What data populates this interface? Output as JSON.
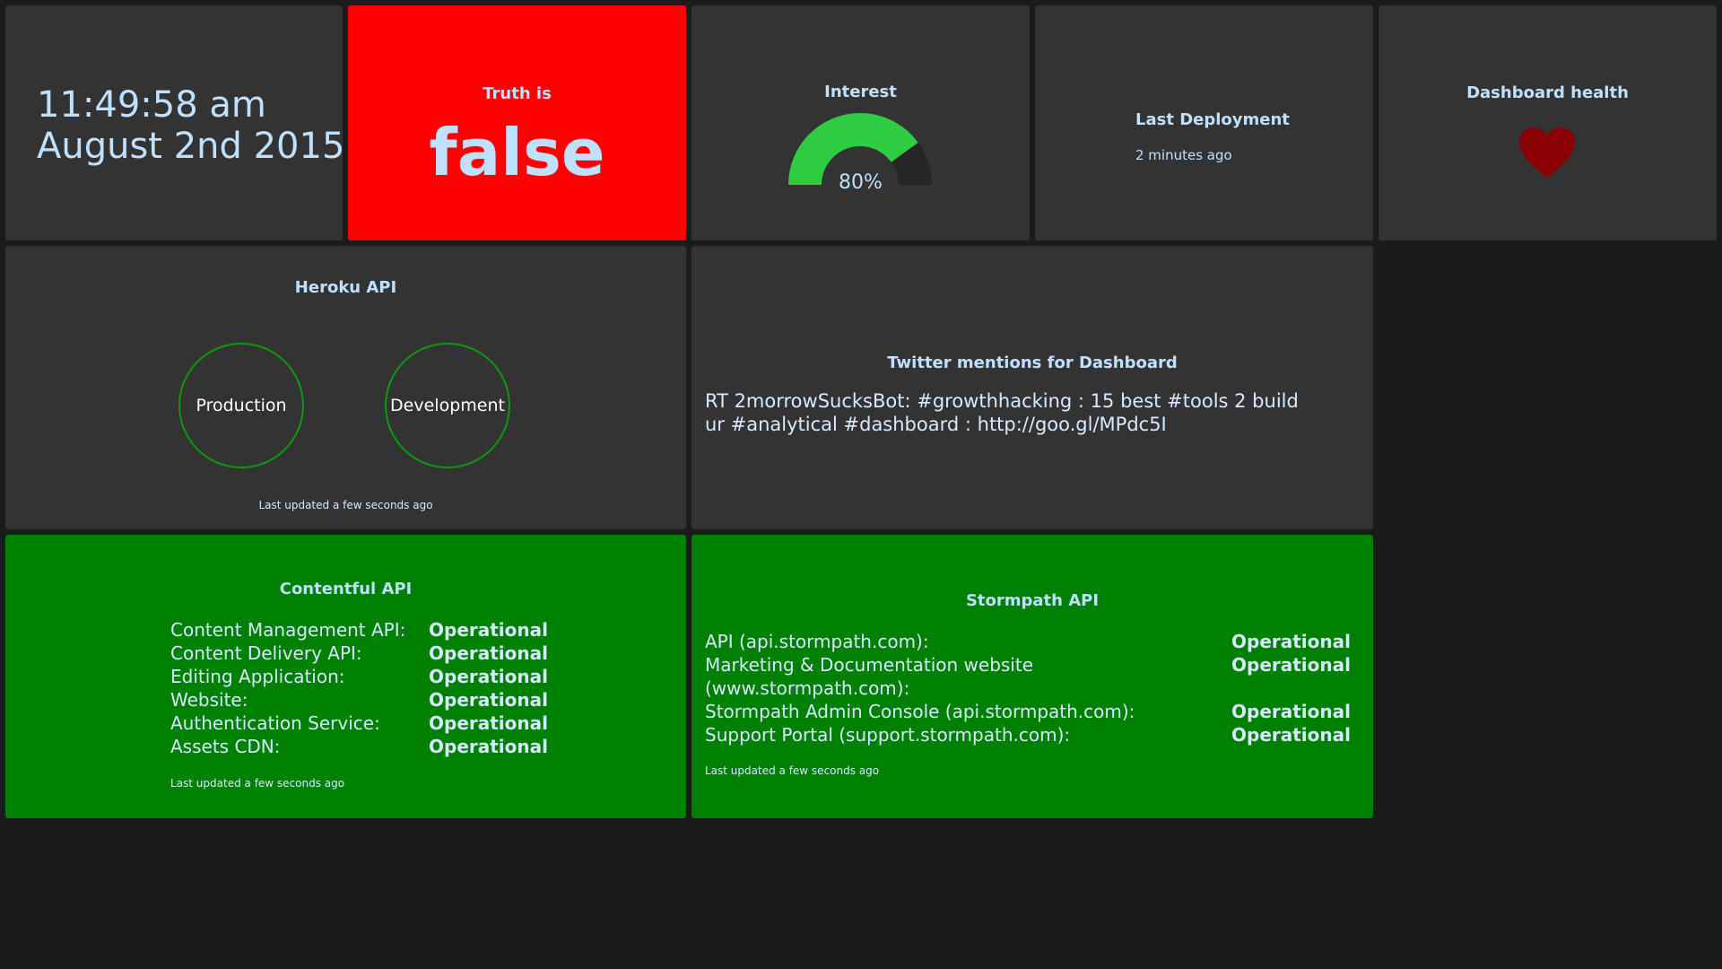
{
  "clock": {
    "time": "11:49:58 am",
    "date": "August 2nd 2015"
  },
  "truth": {
    "title": "Truth is",
    "value": "false"
  },
  "interest": {
    "title": "Interest",
    "value_text": "80%",
    "percent": 80,
    "fill_color": "#2ecc40"
  },
  "deployment": {
    "title": "Last Deployment",
    "text": "2 minutes ago"
  },
  "health": {
    "title": "Dashboard health",
    "icon": "heart-icon",
    "color": "#8b0000"
  },
  "heroku": {
    "title": "Heroku API",
    "envs": [
      "Production",
      "Development"
    ],
    "updated": "Last updated a few seconds ago"
  },
  "twitter": {
    "title": "Twitter mentions for Dashboard",
    "text": "RT 2morrowSucksBot: #growthhacking : 15 best #tools 2 build ur #analytical #dashboard : http://goo.gl/MPdc5I"
  },
  "contentful": {
    "title": "Contentful API",
    "rows": [
      {
        "label": "Content Management API:",
        "status": "Operational"
      },
      {
        "label": "Content Delivery API:",
        "status": "Operational"
      },
      {
        "label": "Editing Application:",
        "status": "Operational"
      },
      {
        "label": "Website:",
        "status": "Operational"
      },
      {
        "label": "Authentication Service:",
        "status": "Operational"
      },
      {
        "label": "Assets CDN:",
        "status": "Operational"
      }
    ],
    "updated": "Last updated a few seconds ago"
  },
  "stormpath": {
    "title": "Stormpath API",
    "rows": [
      {
        "label": "API (api.stormpath.com):",
        "status": "Operational"
      },
      {
        "label": "Marketing & Documentation website",
        "label2": "(www.stormpath.com):",
        "status": "Operational"
      },
      {
        "label": "Stormpath Admin Console (api.stormpath.com):",
        "status": "Operational"
      },
      {
        "label": "Support Portal (support.stormpath.com):",
        "status": "Operational"
      }
    ],
    "updated": "Last updated a few seconds ago"
  }
}
